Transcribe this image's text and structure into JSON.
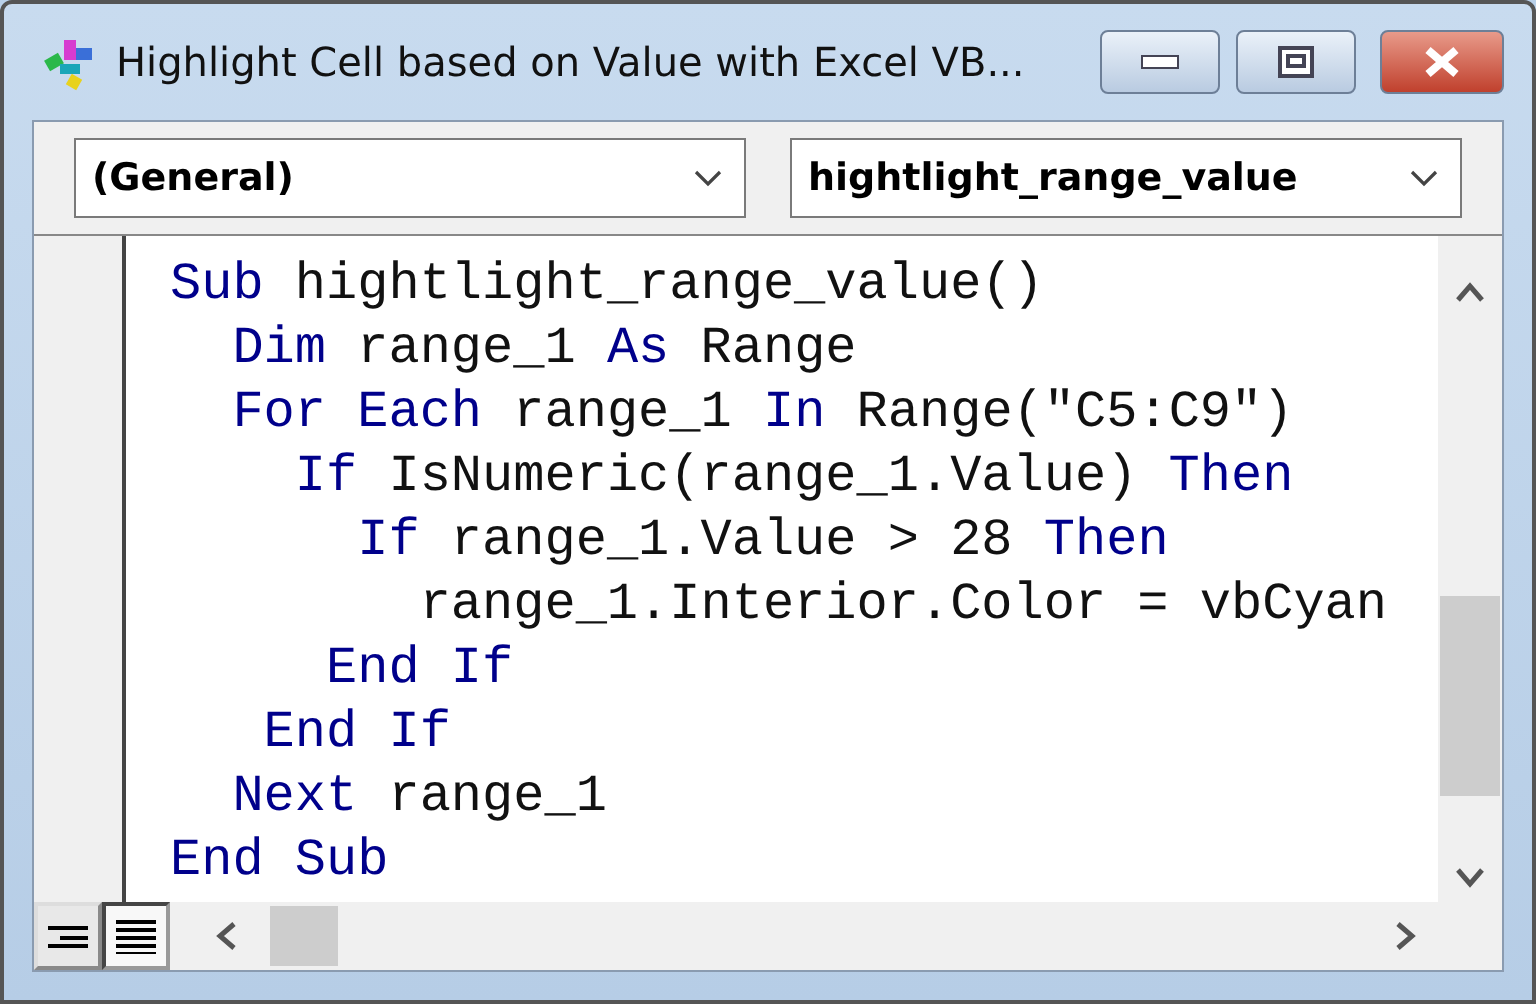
{
  "window": {
    "title": "Highlight Cell based on Value with Excel VB..."
  },
  "dropdowns": [
    {
      "value": "(General)"
    },
    {
      "value": "hightlight_range_value"
    }
  ],
  "code": [
    {
      "tokens": [
        {
          "text": "Sub",
          "kind": "keyword"
        },
        {
          "text": " hightlight_range_value()",
          "kind": "plain"
        }
      ]
    },
    {
      "tokens": [
        {
          "text": "  Dim",
          "kind": "keyword"
        },
        {
          "text": " range_1 ",
          "kind": "plain"
        },
        {
          "text": "As",
          "kind": "keyword"
        },
        {
          "text": " Range",
          "kind": "plain"
        }
      ]
    },
    {
      "tokens": [
        {
          "text": "  For Each",
          "kind": "keyword"
        },
        {
          "text": " range_1 ",
          "kind": "plain"
        },
        {
          "text": "In",
          "kind": "keyword"
        },
        {
          "text": " Range(\"C5:C9\")",
          "kind": "plain"
        }
      ]
    },
    {
      "tokens": [
        {
          "text": "    If",
          "kind": "keyword"
        },
        {
          "text": " IsNumeric(range_1.Value) ",
          "kind": "plain"
        },
        {
          "text": "Then",
          "kind": "keyword"
        }
      ]
    },
    {
      "tokens": [
        {
          "text": "      If",
          "kind": "keyword"
        },
        {
          "text": " range_1.Value > 28 ",
          "kind": "plain"
        },
        {
          "text": "Then",
          "kind": "keyword"
        }
      ]
    },
    {
      "tokens": [
        {
          "text": "        range_1.Interior.Color = vbCyan",
          "kind": "plain"
        }
      ]
    },
    {
      "tokens": [
        {
          "text": "     End If",
          "kind": "keyword"
        }
      ]
    },
    {
      "tokens": [
        {
          "text": "   End If",
          "kind": "keyword"
        }
      ]
    },
    {
      "tokens": [
        {
          "text": "  Next",
          "kind": "keyword"
        },
        {
          "text": " range_1",
          "kind": "plain"
        }
      ]
    },
    {
      "tokens": [
        {
          "text": "End Sub",
          "kind": "keyword"
        }
      ]
    }
  ],
  "view_buttons": [
    {
      "selected": false
    },
    {
      "selected": true
    }
  ]
}
